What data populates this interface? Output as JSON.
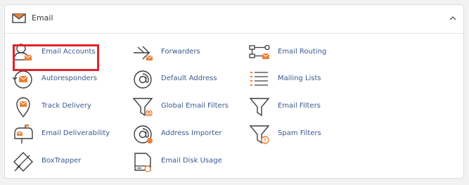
{
  "section": {
    "title": "Email",
    "header_icon": "envelope-icon",
    "collapse_icon": "chevron-up-icon"
  },
  "colors": {
    "accent_orange": "#e8813a",
    "icon_dark": "#3d3d3d",
    "link_blue": "#3b5a8c",
    "highlight_red": "#e0232a"
  },
  "items": [
    {
      "label": "Email Accounts",
      "icon": "email-accounts-icon"
    },
    {
      "label": "Forwarders",
      "icon": "forwarders-icon"
    },
    {
      "label": "Email Routing",
      "icon": "email-routing-icon"
    },
    {
      "label": "Autoresponders",
      "icon": "autoresponders-icon"
    },
    {
      "label": "Default Address",
      "icon": "default-address-icon"
    },
    {
      "label": "Mailing Lists",
      "icon": "mailing-lists-icon"
    },
    {
      "label": "Track Delivery",
      "icon": "track-delivery-icon"
    },
    {
      "label": "Global Email Filters",
      "icon": "global-email-filters-icon"
    },
    {
      "label": "Email Filters",
      "icon": "email-filters-icon"
    },
    {
      "label": "Email Deliverability",
      "icon": "email-deliverability-icon"
    },
    {
      "label": "Address Importer",
      "icon": "address-importer-icon"
    },
    {
      "label": "Spam Filters",
      "icon": "spam-filters-icon"
    },
    {
      "label": "BoxTrapper",
      "icon": "boxtrapper-icon"
    },
    {
      "label": "Email Disk Usage",
      "icon": "email-disk-usage-icon"
    }
  ]
}
